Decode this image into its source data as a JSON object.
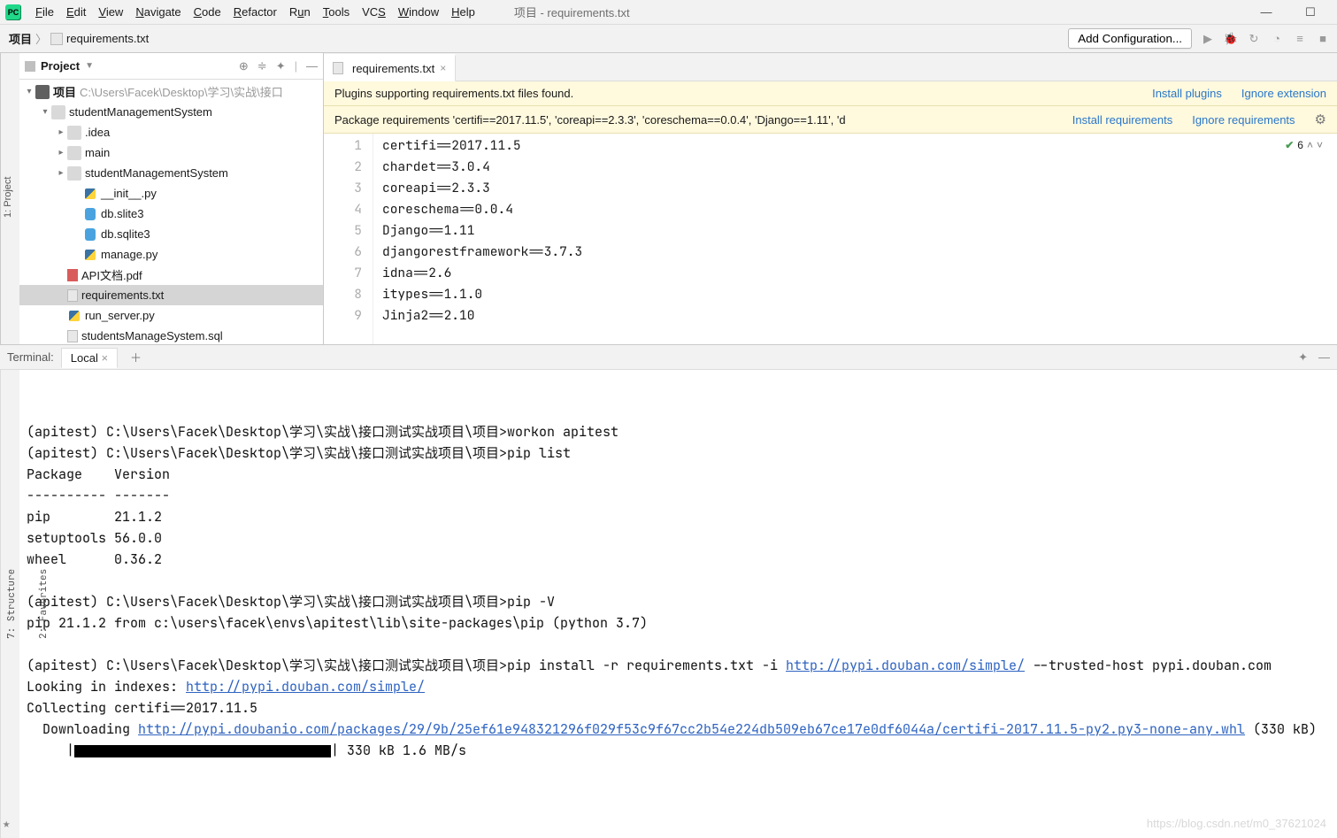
{
  "window": {
    "title_path": "项目 - requirements.txt"
  },
  "menu": {
    "file": "File",
    "edit": "Edit",
    "view": "View",
    "navigate": "Navigate",
    "code": "Code",
    "refactor": "Refactor",
    "run": "Run",
    "tools": "Tools",
    "vcs": "VCS",
    "window": "Window",
    "help": "Help"
  },
  "breadcrumb": {
    "root": "项目",
    "file": "requirements.txt"
  },
  "toolbar": {
    "add_config": "Add Configuration..."
  },
  "sidebar_left": {
    "project": "1: Project"
  },
  "project_panel": {
    "title": "Project",
    "root": "项目",
    "root_path": "C:\\Users\\Facek\\Desktop\\学习\\实战\\接口",
    "items": [
      "studentManagementSystem",
      ".idea",
      "main",
      "studentManagementSystem",
      "__init__.py",
      "db.slite3",
      "db.sqlite3",
      "manage.py",
      "API文档.pdf",
      "requirements.txt",
      "run_server.py",
      "studentsManageSystem.sql"
    ]
  },
  "editor": {
    "tab_label": "requirements.txt",
    "notif1": {
      "text": "Plugins supporting requirements.txt files found.",
      "install": "Install plugins",
      "ignore": "Ignore extension"
    },
    "notif2": {
      "text": "Package requirements 'certifi==2017.11.5', 'coreapi==2.3.3', 'coreschema==0.0.4', 'Django==1.11', 'd",
      "install": "Install requirements",
      "ignore": "Ignore requirements"
    },
    "inspection_count": "6",
    "lines": [
      "certifi==2017.11.5",
      "chardet==3.0.4",
      "coreapi==2.3.3",
      "coreschema==0.0.4",
      "Django==1.11",
      "djangorestframework==3.7.3",
      "idna==2.6",
      "itypes==1.1.0",
      "Jinja2==2.10"
    ]
  },
  "terminal": {
    "title": "Terminal:",
    "tab": "Local",
    "l1": "(apitest) C:\\Users\\Facek\\Desktop\\学习\\实战\\接口测试实战项目\\项目>workon apitest",
    "l2": "(apitest) C:\\Users\\Facek\\Desktop\\学习\\实战\\接口测试实战项目\\项目>pip list",
    "l3": "Package    Version",
    "l4": "---------- -------",
    "l5": "pip        21.1.2",
    "l6": "setuptools 56.0.0",
    "l7": "wheel      0.36.2",
    "l8": "(apitest) C:\\Users\\Facek\\Desktop\\学习\\实战\\接口测试实战项目\\项目>pip -V",
    "l9": "pip 21.1.2 from c:\\users\\facek\\envs\\apitest\\lib\\site-packages\\pip (python 3.7)",
    "l10a": "(apitest) C:\\Users\\Facek\\Desktop\\学习\\实战\\接口测试实战项目\\项目>pip install -r requirements.txt -i ",
    "l10_link": "http://pypi.douban.com/simple/",
    "l10b": " --trusted-host pypi.douban.com",
    "l11a": "Looking in indexes: ",
    "l11_link": "http://pypi.douban.com/simple/",
    "l12": "Collecting certifi==2017.11.5",
    "l13a": "  Downloading ",
    "l13_link": "http://pypi.doubanio.com/packages/29/9b/25ef61e948321296f029f53c9f67cc2b54e224db509eb67ce17e0df6044a/certifi-2017.11.5-py2.py3-none-any.whl",
    "l13b": " (330 kB)",
    "l14": "     |",
    "l14b": "| 330 kB 1.6 MB/s"
  },
  "sidebar_bottom": {
    "structure": "7: Structure",
    "favorites": "2: Favorites"
  },
  "watermark": "https://blog.csdn.net/m0_37621024"
}
